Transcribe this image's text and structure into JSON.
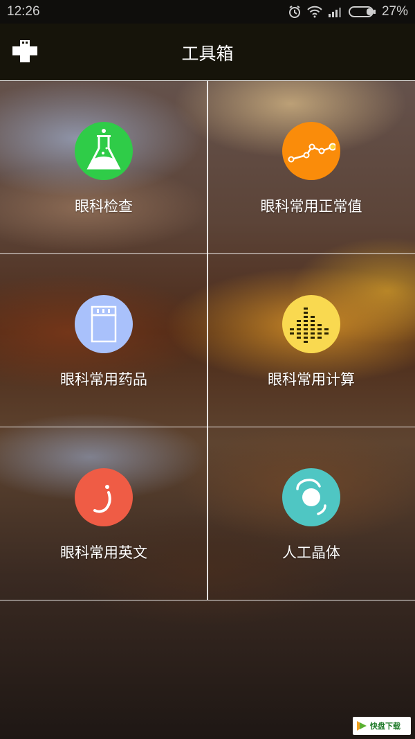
{
  "statusbar": {
    "time": "12:26",
    "battery": "27%",
    "icons": [
      "alarm-icon",
      "wifi-icon",
      "signal-icon",
      "battery-icon"
    ]
  },
  "appbar": {
    "title": "工具箱",
    "menu_icon": "medical-cross-icon"
  },
  "tools": [
    {
      "label": "眼科检查",
      "icon": "flask-icon",
      "color": "#2fcc48"
    },
    {
      "label": "眼科常用正常值",
      "icon": "line-chart-icon",
      "color": "#fa8c0a"
    },
    {
      "label": "眼科常用药品",
      "icon": "medicine-bottle-icon",
      "color": "#a9c1fb"
    },
    {
      "label": "眼科常用计算",
      "icon": "equalizer-icon",
      "color": "#f9d950"
    },
    {
      "label": "眼科常用英文",
      "icon": "letter-icon",
      "color": "#ef5c45"
    },
    {
      "label": "人工晶体",
      "icon": "lens-icon",
      "color": "#4fc6c3"
    }
  ],
  "watermark": {
    "text": "快盘下载"
  }
}
